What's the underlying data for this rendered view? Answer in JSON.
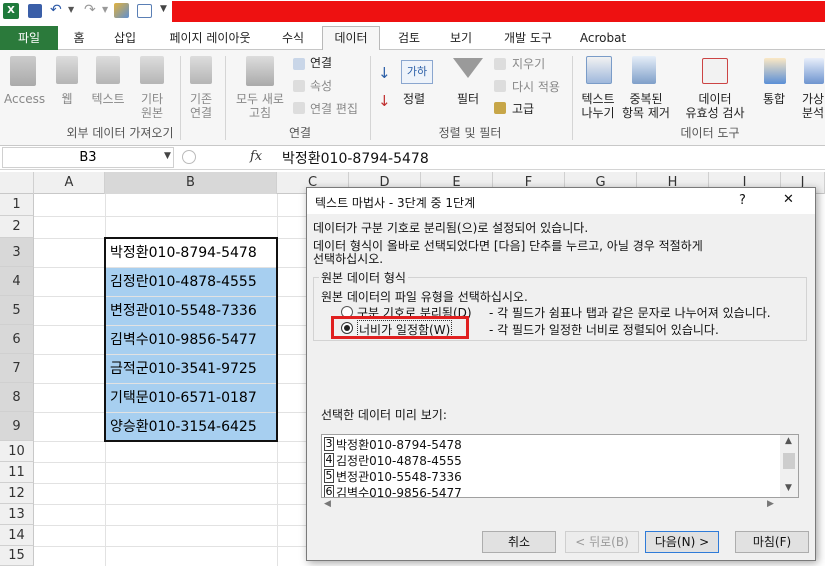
{
  "quick_access": {
    "icons": [
      "excel-icon",
      "save-icon",
      "undo-icon",
      "redo-icon",
      "spellcheck-icon",
      "form-icon",
      "dropdown-icon"
    ]
  },
  "tabs": [
    {
      "label": "파일"
    },
    {
      "label": "홈"
    },
    {
      "label": "삽입"
    },
    {
      "label": "페이지 레이아웃"
    },
    {
      "label": "수식"
    },
    {
      "label": "데이터"
    },
    {
      "label": "검토"
    },
    {
      "label": "보기"
    },
    {
      "label": "개발 도구"
    },
    {
      "label": "Acrobat"
    }
  ],
  "ribbon": {
    "access": "Access",
    "web": "웹",
    "text": "텍스트",
    "other_1": "기타",
    "other_2": "원본",
    "existing_1": "기존",
    "existing_2": "연결",
    "refresh_1": "모두 새로",
    "refresh_2": "고침",
    "connections": "연결",
    "properties": "속성",
    "edit_links": "연결 편집",
    "sort": "정렬",
    "filter": "필터",
    "clear": "지우기",
    "reapply": "다시 적용",
    "advanced": "고급",
    "text_to_columns_1": "텍스트",
    "text_to_columns_2": "나누기",
    "remove_dup_1": "중복된",
    "remove_dup_2": "항목 제거",
    "validation_1": "데이터",
    "validation_2": "유효성 검사",
    "consolidate": "통합",
    "whatif_1": "가상",
    "whatif_2": "분석",
    "group_external": "외부 데이터 가져오기",
    "group_connections": "연결",
    "group_sort": "정렬 및 필터",
    "group_tools": "데이터 도구",
    "sort_az": "가하",
    "colors": {
      "accent": "#2b7a3b",
      "selection": "#a7cff0",
      "highlight_box": "#e02020"
    }
  },
  "formula_bar": {
    "name_box": "B3",
    "fx": "fx",
    "content": "박정환010-8794-5478"
  },
  "columns": [
    "A",
    "B",
    "C",
    "D",
    "E",
    "F",
    "G",
    "H",
    "I",
    "J"
  ],
  "rows": [
    "1",
    "2",
    "3",
    "4",
    "5",
    "6",
    "7",
    "8",
    "9",
    "10",
    "11",
    "12",
    "13",
    "14",
    "15"
  ],
  "cells": [
    "박정환010-8794-5478",
    "김정란010-4878-4555",
    "변정관010-5548-7336",
    "김벽수010-9856-5477",
    "금적군010-3541-9725",
    "기택문010-6571-0187",
    "양승환010-3154-6425"
  ],
  "dialog": {
    "title": "텍스트 마법사 - 3단계 중 1단계",
    "help": "?",
    "close": "✕",
    "line1": "데이터가 구분 기호로 분리됨(으)로 설정되어 있습니다.",
    "line2": "데이터 형식이 올바로 선택되었다면 [다음] 단추를 누르고, 아닐 경우 적절하게",
    "line3": "선택하십시오.",
    "group_label": "원본 데이터 형식",
    "group_prompt": "원본 데이터의 파일 유형을 선택하십시오.",
    "opt1_label": "구분 기호로 분리됨(D)",
    "opt1_desc": "- 각 필드가 쉼표나 탭과 같은 문자로 나누어져 있습니다.",
    "opt2_label": "너비가 일정함(W)",
    "opt2_desc": "- 각 필드가 일정한 너비로 정렬되어 있습니다.",
    "preview_label": "선택한 데이터 미리 보기:",
    "preview_rows": [
      {
        "num": "3",
        "text": "박정환010-8794-5478"
      },
      {
        "num": "4",
        "text": "김정란010-4878-4555"
      },
      {
        "num": "5",
        "text": "변정관010-5548-7336"
      },
      {
        "num": "6",
        "text": "김벽수010-9856-5477"
      }
    ],
    "cancel": "취소",
    "back": "< 뒤로(B)",
    "next": "다음(N) >",
    "finish": "마침(F)"
  }
}
